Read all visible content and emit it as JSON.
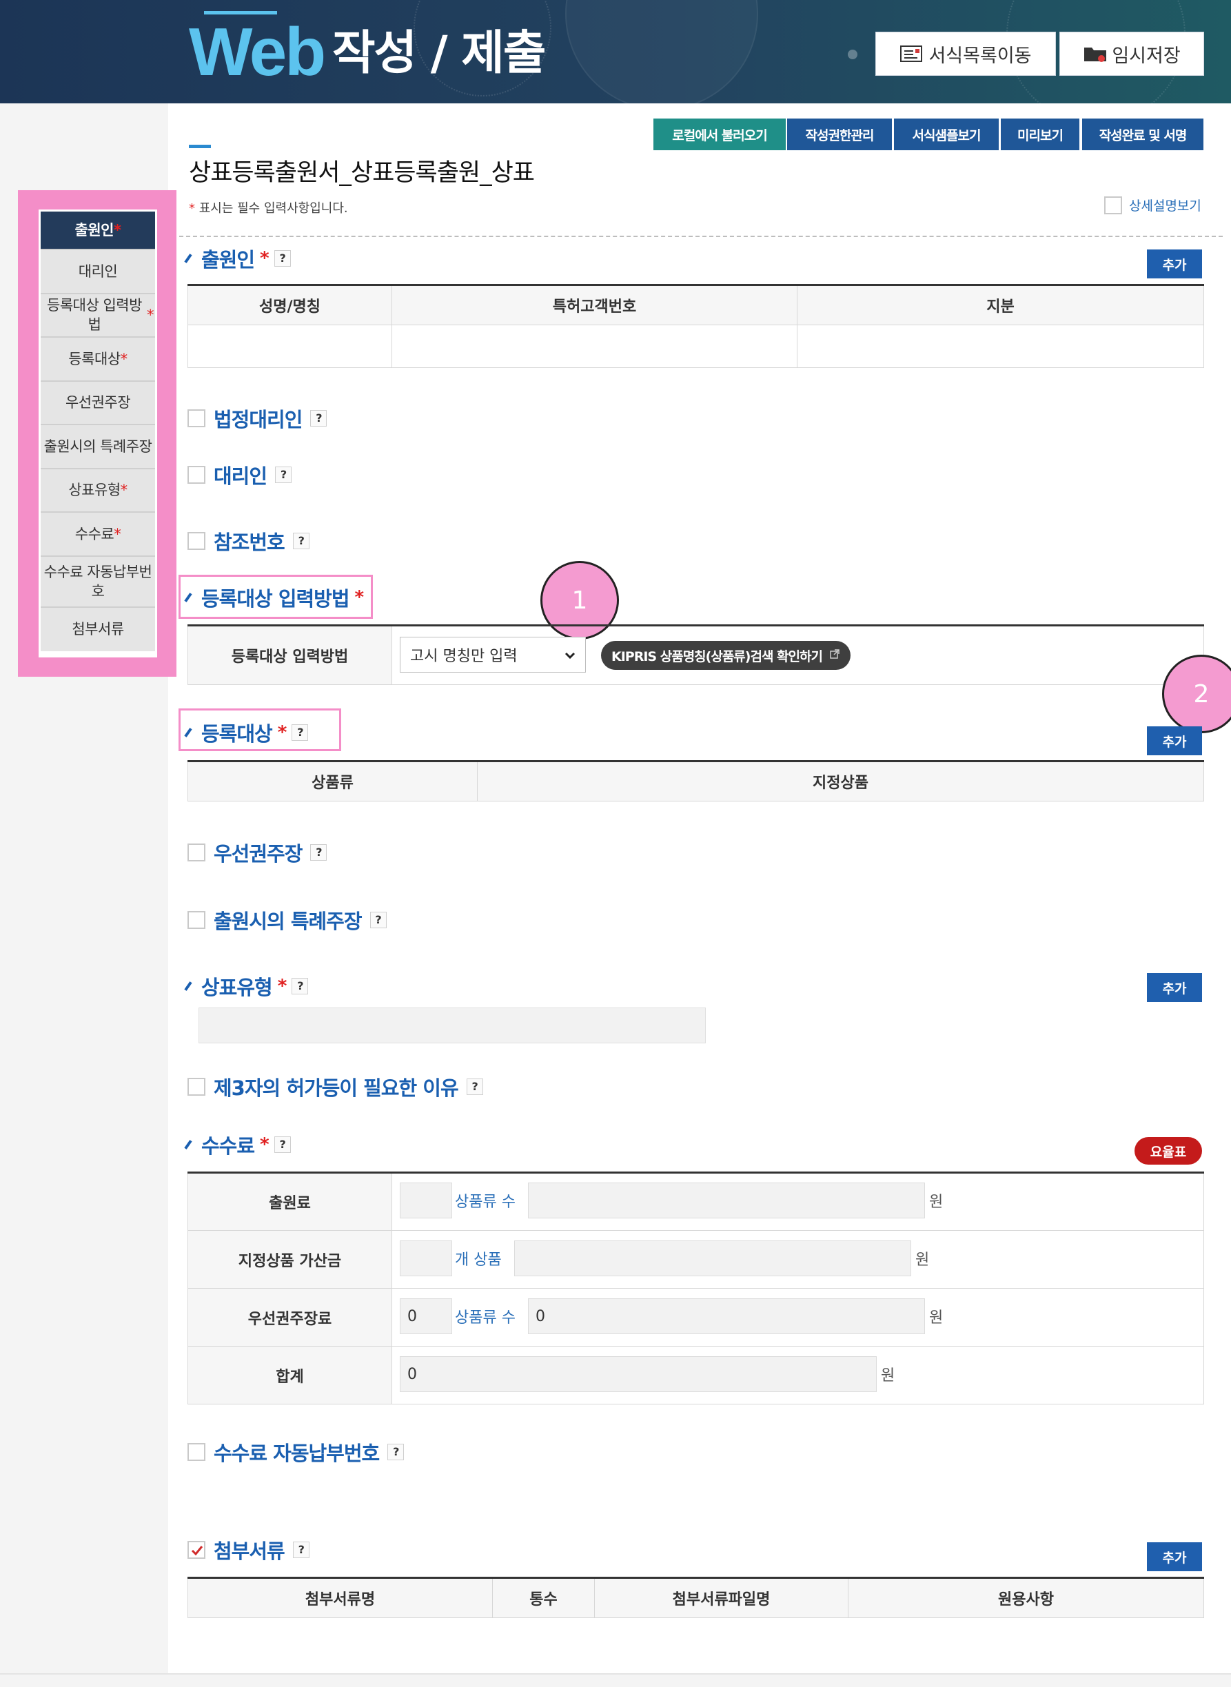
{
  "header": {
    "logo": "Web",
    "title": "작성 / 제출",
    "buttons": {
      "form_list": "서식목록이동",
      "temp_save": "임시저장"
    }
  },
  "sidebar": {
    "items": [
      {
        "label": "출원인",
        "required": "*"
      },
      {
        "label": "대리인",
        "required": ""
      },
      {
        "label": "등록대상 입력방법",
        "required": "*"
      },
      {
        "label": "등록대상",
        "required": "*"
      },
      {
        "label": "우선권주장",
        "required": ""
      },
      {
        "label": "출원시의 특례주장",
        "required": ""
      },
      {
        "label": "상표유형",
        "required": "*"
      },
      {
        "label": "수수료",
        "required": "*"
      },
      {
        "label": "수수료 자동납부번호",
        "required": ""
      },
      {
        "label": "첨부서류",
        "required": ""
      }
    ]
  },
  "toolbar": {
    "load_local": "로컬에서 불러오기",
    "permission": "작성권한관리",
    "sample": "서식샘플보기",
    "preview": "미리보기",
    "complete_sign": "작성완료 및 서명"
  },
  "page": {
    "title": "상표등록출원서_상표등록출원_상표",
    "required_note_star": "*",
    "required_note": " 표시는 필수 입력사항입니다.",
    "detail_toggle": "상세설명보기"
  },
  "common": {
    "help": "?",
    "add": "추가",
    "required_star": "*"
  },
  "applicant": {
    "title": "출원인",
    "columns": [
      "성명/명칭",
      "특허고객번호",
      "지분"
    ]
  },
  "optional": {
    "legal_agent": "법정대리인",
    "agent": "대리인",
    "reference": "참조번호"
  },
  "input_method": {
    "title": "등록대상 입력방법",
    "row_label": "등록대상 입력방법",
    "selected": "고시 명칭만 입력",
    "kipris": "KIPRIS 상품명칭(상품류)검색 확인하기"
  },
  "target": {
    "title": "등록대상",
    "columns": [
      "상품류",
      "지정상품"
    ]
  },
  "priority": "우선권주장",
  "special": "출원시의 특례주장",
  "tm_type": {
    "title": "상표유형"
  },
  "third_party": "제3자의 허가등이 필요한 이유",
  "fee": {
    "title": "수수료",
    "rate_table": "요율표",
    "rows": [
      {
        "label": "출원료",
        "count": "",
        "unit": "상품류 수",
        "amount": "",
        "won": "원"
      },
      {
        "label": "지정상품 가산금",
        "count": "",
        "unit": "개 상품",
        "amount": "",
        "won": "원"
      },
      {
        "label": "우선권주장료",
        "count": "0",
        "unit": "상품류 수",
        "amount": "0",
        "won": "원"
      },
      {
        "label": "합계",
        "count": "",
        "unit": "",
        "amount": "0",
        "won": "원"
      }
    ]
  },
  "auto_pay": "수수료 자동납부번호",
  "attachments": {
    "title": "첨부서류",
    "columns": [
      "첨부서류명",
      "통수",
      "첨부서류파일명",
      "원용사항"
    ]
  },
  "callouts": [
    "1",
    "2"
  ],
  "colors": {
    "header_bg": "#1c3556",
    "logo": "#5cc3ee",
    "accent_blue": "#1f5fae",
    "teal": "#1f8f88",
    "highlight_pink": "#f48ec8",
    "rate_red": "#c41b1b"
  }
}
